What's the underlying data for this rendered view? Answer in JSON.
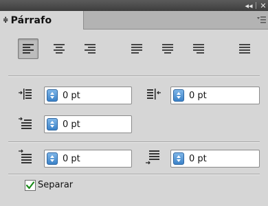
{
  "panel": {
    "tab_title": "Párrafo",
    "tab_arrow": "≑",
    "collapse_glyph": "◂◂",
    "close_glyph": "✕"
  },
  "alignment": {
    "selected": "align-left",
    "buttons": [
      "align-left",
      "align-center",
      "align-right",
      "justify-left",
      "justify-center",
      "justify-right",
      "justify-all"
    ]
  },
  "indents": {
    "left_indent": "0 pt",
    "right_indent": "0 pt",
    "first_line_indent": "0 pt"
  },
  "spacing": {
    "space_before": "0 pt",
    "space_after": "0 pt"
  },
  "hyphenate": {
    "label": "Separar",
    "checked": true
  }
}
